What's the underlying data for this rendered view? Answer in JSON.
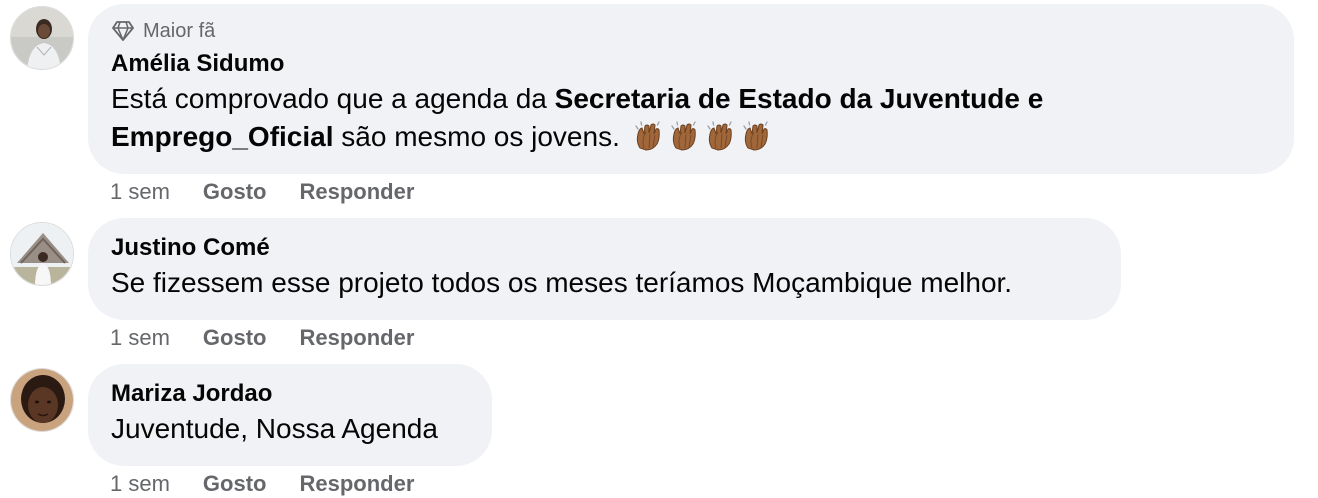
{
  "comments": [
    {
      "badge": "Maior fã",
      "author": "Amélia Sidumo",
      "text_before": "Está comprovado que a agenda da ",
      "text_bold": "Secretaria de Estado da Juventude e Emprego_Oficial",
      "text_after": " são mesmo os jovens.",
      "emoji": "clapping-hands",
      "emoji_count": 4,
      "time": "1 sem",
      "like_label": "Gosto",
      "reply_label": "Responder"
    },
    {
      "author": "Justino Comé",
      "text": "Se fizessem esse projeto todos os meses teríamos Moçambique melhor.",
      "time": "1 sem",
      "like_label": "Gosto",
      "reply_label": "Responder"
    },
    {
      "author": "Mariza Jordao",
      "text": "Juventude, Nossa Agenda",
      "time": "1 sem",
      "like_label": "Gosto",
      "reply_label": "Responder"
    }
  ],
  "colors": {
    "bubble": "#f0f2f5",
    "secondary_text": "#65676b",
    "primary_text": "#050505",
    "clap": "#a0673a"
  }
}
